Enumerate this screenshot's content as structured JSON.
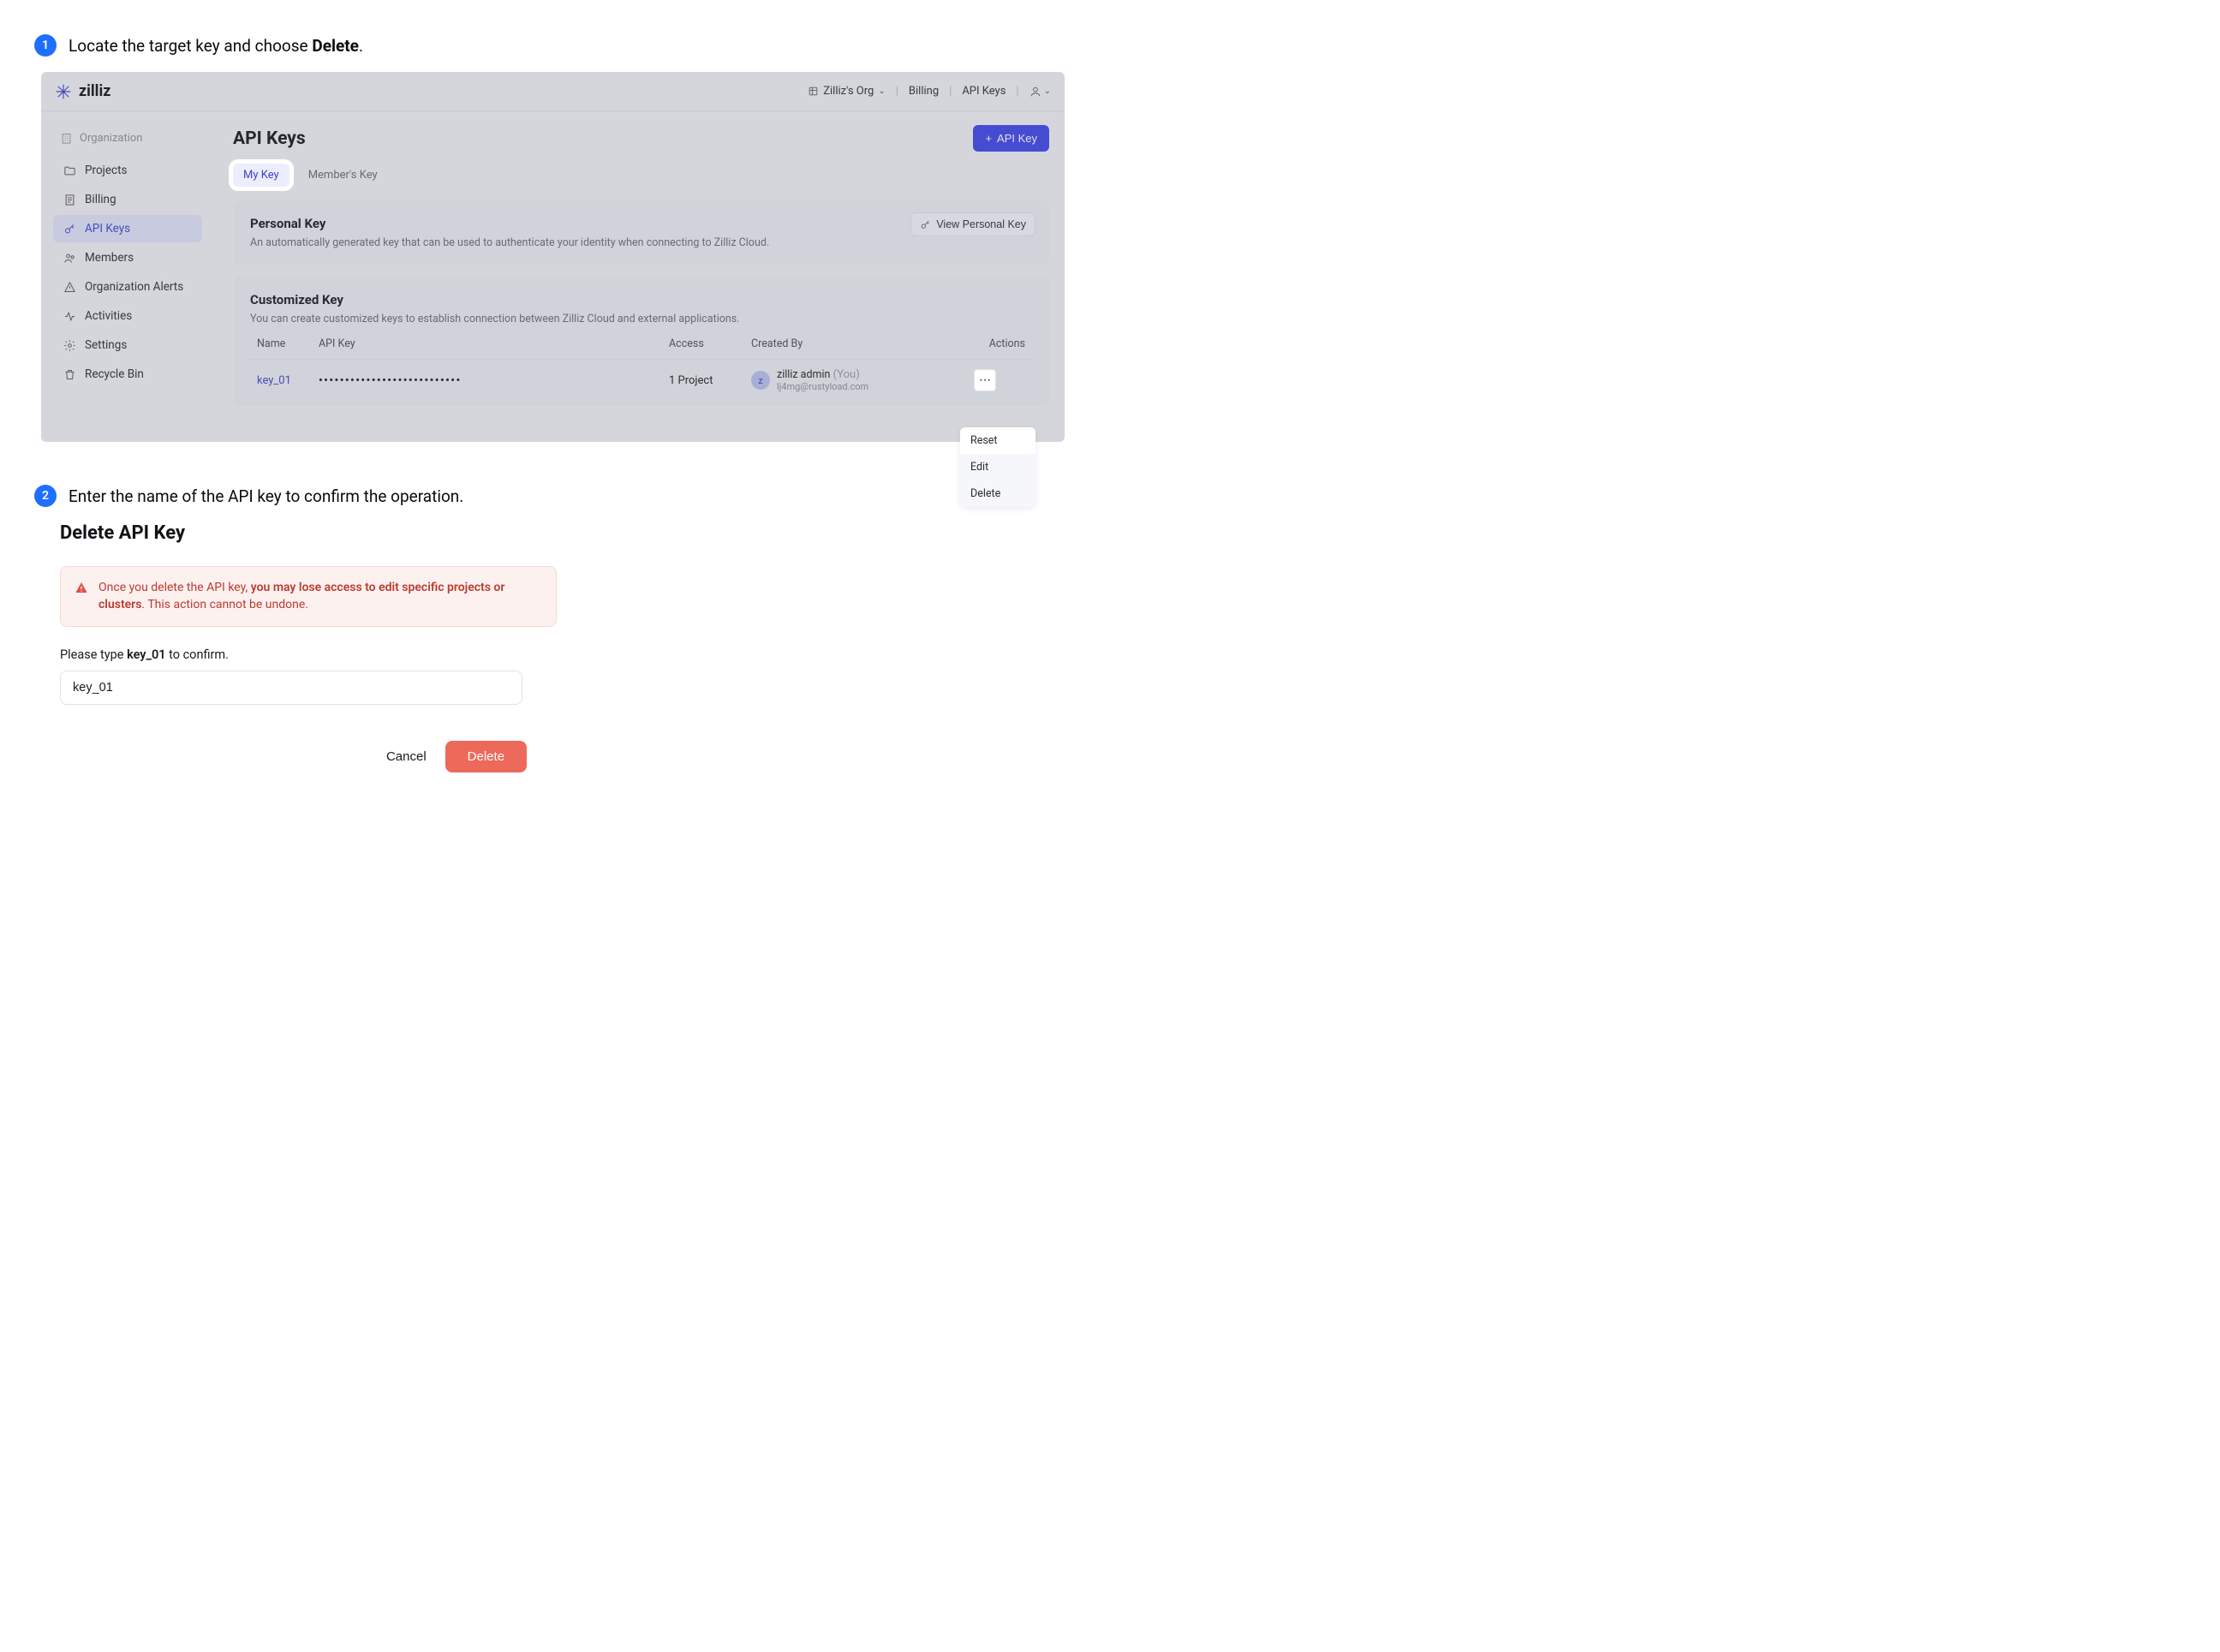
{
  "step1": {
    "num": "1",
    "text_pre": "Locate the target key and choose ",
    "text_bold": "Delete",
    "text_post": "."
  },
  "topbar": {
    "brand": "zilliz",
    "org": "Zilliz's Org",
    "billing": "Billing",
    "apikeys": "API Keys"
  },
  "sidebar": {
    "section": "Organization",
    "items": [
      {
        "label": "Projects"
      },
      {
        "label": "Billing"
      },
      {
        "label": "API Keys"
      },
      {
        "label": "Members"
      },
      {
        "label": "Organization Alerts"
      },
      {
        "label": "Activities"
      },
      {
        "label": "Settings"
      },
      {
        "label": "Recycle Bin"
      }
    ]
  },
  "page": {
    "title": "API Keys",
    "add_btn": "API Key",
    "tabs": {
      "mykey": "My Key",
      "memberkey": "Member's Key"
    }
  },
  "personal": {
    "title": "Personal Key",
    "desc": "An automatically generated key that can be used to authenticate your identity when connecting to Zilliz Cloud.",
    "view_btn": "View Personal Key"
  },
  "custom": {
    "title": "Customized Key",
    "desc": "You can create customized keys to establish connection between Zilliz Cloud and external applications.",
    "cols": {
      "name": "Name",
      "key": "API Key",
      "access": "Access",
      "by": "Created By",
      "actions": "Actions"
    },
    "row": {
      "name": "key_01",
      "masked": "•••••••••••••••••••••••••••",
      "access": "1 Project",
      "by_name": "zilliz admin",
      "by_you": " (You)",
      "by_email": "lj4mg@rustyload.com"
    },
    "menu": {
      "reset": "Reset",
      "edit": "Edit",
      "delete": "Delete"
    }
  },
  "step2": {
    "num": "2",
    "text": "Enter the name of the API key to confirm the operation."
  },
  "dialog": {
    "title": "Delete API Key",
    "warn_pre": "Once you delete the API key, ",
    "warn_bold": "you may lose access to edit specific projects or clusters",
    "warn_post": ". This action cannot be undone.",
    "confirm_pre": "Please type ",
    "confirm_key": "key_01",
    "confirm_post": " to confirm.",
    "input_value": "key_01",
    "cancel": "Cancel",
    "delete": "Delete"
  }
}
